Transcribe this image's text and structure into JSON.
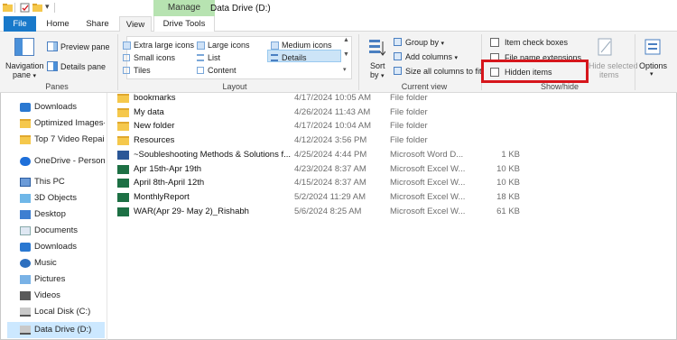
{
  "title_bar": {
    "title": "Data Drive (D:)",
    "contextual_tab": "Manage"
  },
  "ribbon_tabs": {
    "file": "File",
    "home": "Home",
    "share": "Share",
    "view": "View",
    "drive_tools": "Drive Tools"
  },
  "panes_group": {
    "navigation_pane_1": "Navigation",
    "navigation_pane_2": "pane",
    "preview_pane": "Preview pane",
    "details_pane": "Details pane",
    "label": "Panes"
  },
  "layout_group": {
    "extra_large_icons": "Extra large icons",
    "large_icons": "Large icons",
    "medium_icons": "Medium icons",
    "small_icons": "Small icons",
    "list": "List",
    "details": "Details",
    "tiles": "Tiles",
    "content": "Content",
    "label": "Layout"
  },
  "current_view_group": {
    "sort_by_1": "Sort",
    "sort_by_2": "by",
    "group_by": "Group by",
    "add_columns": "Add columns",
    "size_all_columns": "Size all columns to fit",
    "label": "Current view"
  },
  "show_hide_group": {
    "item_check_boxes": "Item check boxes",
    "file_name_extensions": "File name extensions",
    "hidden_items": "Hidden items",
    "hide_selected_1": "Hide selected",
    "hide_selected_2": "items",
    "label": "Show/hide"
  },
  "options": {
    "label": "Options"
  },
  "nav_pane": [
    {
      "label": "Downloads",
      "icon": "download-icon"
    },
    {
      "label": "Optimized Images-",
      "icon": "folder-icon"
    },
    {
      "label": "Top 7 Video Repair S",
      "icon": "folder-icon"
    },
    {
      "label": "OneDrive - Personal",
      "icon": "cloud-icon"
    },
    {
      "label": "This PC",
      "icon": "computer-icon"
    },
    {
      "label": "3D Objects",
      "icon": "cube-icon"
    },
    {
      "label": "Desktop",
      "icon": "desktop-icon"
    },
    {
      "label": "Documents",
      "icon": "documents-icon"
    },
    {
      "label": "Downloads",
      "icon": "download-icon"
    },
    {
      "label": "Music",
      "icon": "music-icon"
    },
    {
      "label": "Pictures",
      "icon": "pictures-icon"
    },
    {
      "label": "Videos",
      "icon": "videos-icon"
    },
    {
      "label": "Local Disk (C:)",
      "icon": "drive-icon"
    },
    {
      "label": "Data Drive (D:)",
      "icon": "drive-icon"
    }
  ],
  "files": [
    {
      "name": "bookmarks",
      "date": "4/17/2024 10:05 AM",
      "type": "File folder",
      "size": "",
      "icon": "folder-icon"
    },
    {
      "name": "My data",
      "date": "4/26/2024 11:43 AM",
      "type": "File folder",
      "size": "",
      "icon": "folder-icon"
    },
    {
      "name": "New folder",
      "date": "4/17/2024 10:04 AM",
      "type": "File folder",
      "size": "",
      "icon": "folder-icon"
    },
    {
      "name": "Resources",
      "date": "4/12/2024 3:56 PM",
      "type": "File folder",
      "size": "",
      "icon": "folder-icon"
    },
    {
      "name": "~Soubleshooting Methods & Solutions f...",
      "date": "4/25/2024 4:44 PM",
      "type": "Microsoft Word D...",
      "size": "1 KB",
      "icon": "word-doc-icon"
    },
    {
      "name": "Apr 15th-Apr 19th",
      "date": "4/23/2024 8:37 AM",
      "type": "Microsoft Excel W...",
      "size": "10 KB",
      "icon": "excel-icon"
    },
    {
      "name": "April 8th-April 12th",
      "date": "4/15/2024 8:37 AM",
      "type": "Microsoft Excel W...",
      "size": "10 KB",
      "icon": "excel-icon"
    },
    {
      "name": "MonthlyReport",
      "date": "5/2/2024 11:29 AM",
      "type": "Microsoft Excel W...",
      "size": "18 KB",
      "icon": "excel-icon"
    },
    {
      "name": "WAR(Apr 29- May 2)_Rishabh",
      "date": "5/6/2024 8:25 AM",
      "type": "Microsoft Excel W...",
      "size": "61 KB",
      "icon": "excel-icon"
    }
  ],
  "colors": {
    "accent": "#1979ca",
    "manage_tab": "#b7e3b1",
    "highlight_box": "#d6161c",
    "selection": "#cce8ff"
  }
}
